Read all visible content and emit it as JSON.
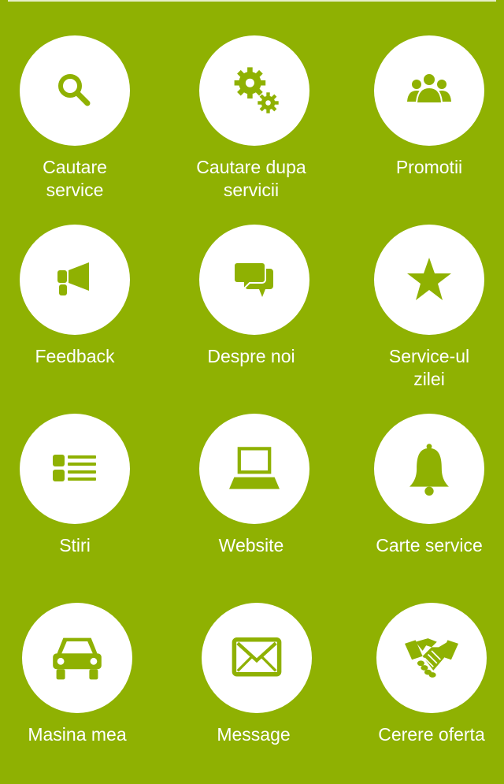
{
  "colors": {
    "background": "#8fb102",
    "icon": "#8fb102",
    "circle": "#ffffff",
    "text": "#ffffff"
  },
  "menu": {
    "items": [
      {
        "label_line1": "Cautare",
        "label_line2": "service",
        "icon": "search-icon"
      },
      {
        "label_line1": "Cautare dupa",
        "label_line2": "servicii",
        "icon": "gears-icon"
      },
      {
        "label_line1": "Promotii",
        "label_line2": "",
        "icon": "group-icon"
      },
      {
        "label_line1": "Feedback",
        "label_line2": "",
        "icon": "megaphone-icon"
      },
      {
        "label_line1": "Despre noi",
        "label_line2": "",
        "icon": "chat-bubbles-icon"
      },
      {
        "label_line1": "Service-ul",
        "label_line2": "zilei",
        "icon": "star-icon"
      },
      {
        "label_line1": "Stiri",
        "label_line2": "",
        "icon": "list-icon"
      },
      {
        "label_line1": "Website",
        "label_line2": "",
        "icon": "laptop-icon"
      },
      {
        "label_line1": "Carte service",
        "label_line2": "",
        "icon": "bell-icon"
      },
      {
        "label_line1": "Masina mea",
        "label_line2": "",
        "icon": "car-icon"
      },
      {
        "label_line1": "Message",
        "label_line2": "",
        "icon": "envelope-icon"
      },
      {
        "label_line1": "Cerere oferta",
        "label_line2": "",
        "icon": "handshake-icon"
      }
    ]
  }
}
